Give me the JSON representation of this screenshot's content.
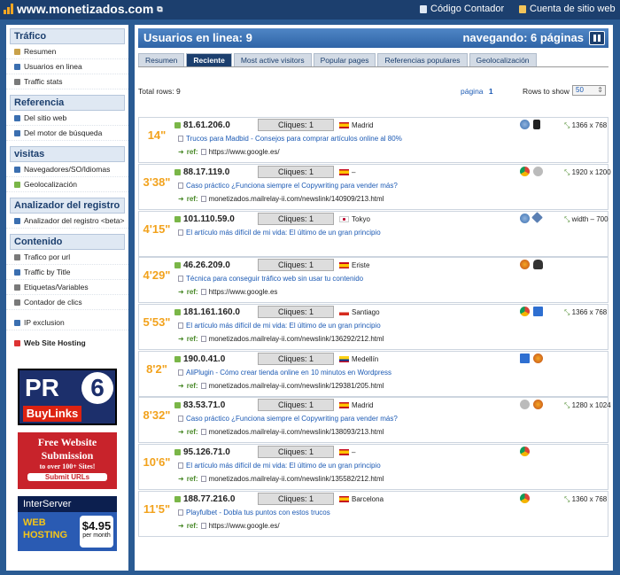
{
  "site": {
    "logo": "www.monetizados.com",
    "codigo": "Código Contador",
    "cuenta": "Cuenta de sitio web"
  },
  "sidebar": [
    {
      "title": "Tráfico",
      "items": [
        "Resumen",
        "Usuarios en linea",
        "Traffic stats"
      ]
    },
    {
      "title": "Referencia",
      "items": [
        "Del sitio web",
        "Del motor de búsqueda"
      ]
    },
    {
      "title": "visitas",
      "items": [
        "Navegadores/SO/Idiomas",
        "Geolocalización"
      ]
    },
    {
      "title": "Analizador del registro",
      "items": [
        "Analizador del registro <beta>"
      ]
    },
    {
      "title": "Contenido",
      "items": [
        "Trafico por url",
        "Traffic by Title",
        "Etiquetas/Variables",
        "Contador de clics"
      ]
    }
  ],
  "extra": {
    "ip_exclusion": "IP exclusion",
    "hosting": "Web Site Hosting"
  },
  "ads": {
    "pr": "PR",
    "pr_num": "6",
    "buy": "BuyLinks",
    "free1": "Free Website",
    "free2": "Submission",
    "free3": "to over 100+ Sites!",
    "free4": "Submit URLs",
    "inter": "InterServer",
    "web": "WEB",
    "hosting": "HOSTING",
    "price": "$4.95",
    "per": "per month"
  },
  "header": {
    "left": "Usuarios en linea: 9",
    "right": "navegando: 6 páginas"
  },
  "tabs": [
    "Resumen",
    "Reciente",
    "Most active visitors",
    "Popular pages",
    "Referencias populares",
    "Geolocalización"
  ],
  "meta": {
    "total": "Total rows: 9",
    "pagina_label": "página",
    "pagina": "1",
    "rows_label": "Rows to show",
    "rows_value": "50"
  },
  "colors": {
    "accent": "#f2a21c",
    "header": "#2f64a6",
    "link": "#1c5ab4"
  },
  "rows": [
    {
      "dur": "14\"",
      "ip": "81.61.206.0",
      "clicks": "Cliques: 1",
      "flag": "es",
      "city": "Madrid",
      "title": "Trucos para Madbid - Consejos para comprar artículos online al 80%",
      "ref": "https://www.google.es/",
      "icons": [
        "globe-icon",
        "phone-icon"
      ],
      "res": "1366 x 768"
    },
    {
      "dur": "3'38\"",
      "ip": "88.17.119.0",
      "clicks": "Cliques: 1",
      "flag": "es",
      "city": "–",
      "title": "Caso práctico ¿Funciona siempre el Copywriting para vender más?",
      "ref": "monetizados.mailrelay-ii.com/newslink/140909/213.html",
      "icons": [
        "chrome-icon",
        "apple-icon"
      ],
      "res": "1920 x 1200"
    },
    {
      "dur": "4'15\"",
      "ip": "101.110.59.0",
      "clicks": "Cliques: 1",
      "flag": "jp",
      "city": "Tokyo",
      "title": "El artículo más difícil de mi vida: El último de un gran principio",
      "ref": "",
      "icons": [
        "globe-icon",
        "diamond-icon"
      ],
      "res": "width – 700"
    },
    {
      "dur": "4'29\"",
      "ip": "46.26.209.0",
      "clicks": "Cliques: 1",
      "flag": "es",
      "city": "Eriste",
      "title": "Técnica para conseguir tráfico web sin usar tu contenido",
      "ref": "https://www.google.es",
      "icons": [
        "firefox-icon",
        "linux-icon"
      ],
      "res": ""
    },
    {
      "dur": "5'53\"",
      "ip": "181.161.160.0",
      "clicks": "Cliques: 1",
      "flag": "cl",
      "city": "Santiago",
      "title": "El artículo más difícil de mi vida: El último de un gran principio",
      "ref": "monetizados.mailrelay-ii.com/newslink/136292/212.html",
      "icons": [
        "chrome-icon",
        "windows-icon"
      ],
      "res": "1366 x 768"
    },
    {
      "dur": "8'2\"",
      "ip": "190.0.41.0",
      "clicks": "Cliques: 1",
      "flag": "co",
      "city": "Medellín",
      "title": "AliPlugin - Cómo crear tienda online en 10 minutos en Wordpress",
      "ref": "monetizados.mailrelay-ii.com/newslink/129381/205.html",
      "icons": [
        "windows-icon",
        "firefox-icon"
      ],
      "res": ""
    },
    {
      "dur": "8'32\"",
      "ip": "83.53.71.0",
      "clicks": "Cliques: 1",
      "flag": "es",
      "city": "Madrid",
      "title": "Caso práctico ¿Funciona siempre el Copywriting para vender más?",
      "ref": "monetizados.mailrelay-ii.com/newslink/138093/213.html",
      "icons": [
        "apple-icon",
        "firefox-icon"
      ],
      "res": "1280 x 1024"
    },
    {
      "dur": "10'6\"",
      "ip": "95.126.71.0",
      "clicks": "Cliques: 1",
      "flag": "es",
      "city": "–",
      "title": "El artículo más difícil de mi vida: El último de un gran principio",
      "ref": "monetizados.mailrelay-ii.com/newslink/135582/212.html",
      "icons": [
        "chrome-icon"
      ],
      "res": ""
    },
    {
      "dur": "11'5\"",
      "ip": "188.77.216.0",
      "clicks": "Cliques: 1",
      "flag": "es",
      "city": "Barcelona",
      "title": "Playfulbet - Dobla tus puntos con estos trucos",
      "ref": "https://www.google.es/",
      "icons": [
        "chrome-icon"
      ],
      "res": "1360 x 768"
    }
  ]
}
